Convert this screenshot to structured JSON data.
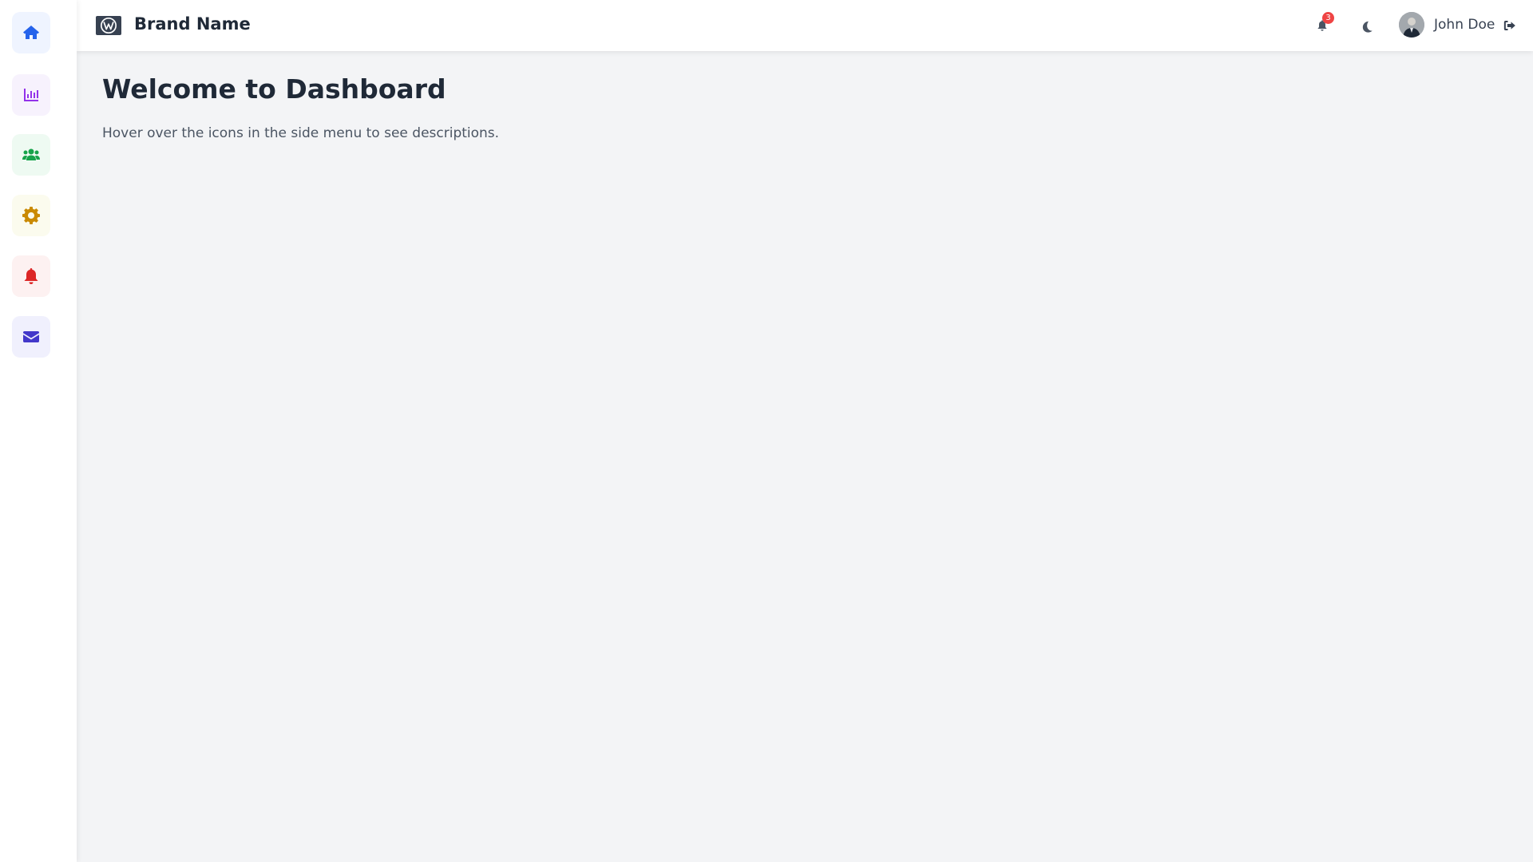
{
  "sidebar": {
    "items": [
      {
        "icon": "home-icon",
        "color": "#2563eb",
        "bg": "#eff4ff"
      },
      {
        "icon": "chart-icon",
        "color": "#9333ea",
        "bg": "#f7f2fd"
      },
      {
        "icon": "users-icon",
        "color": "#16a34a",
        "bg": "#eefaf2"
      },
      {
        "icon": "gear-icon",
        "color": "#ca8a04",
        "bg": "#fbfbee"
      },
      {
        "icon": "bell-icon",
        "color": "#dc2626",
        "bg": "#fdf1f1"
      },
      {
        "icon": "envelope-icon",
        "color": "#4338ca",
        "bg": "#f0f0fd"
      }
    ]
  },
  "header": {
    "brand_name": "Brand Name",
    "notification_count": "3",
    "user_name": "John Doe"
  },
  "main": {
    "title": "Welcome to Dashboard",
    "description": "Hover over the icons in the side menu to see descriptions."
  }
}
